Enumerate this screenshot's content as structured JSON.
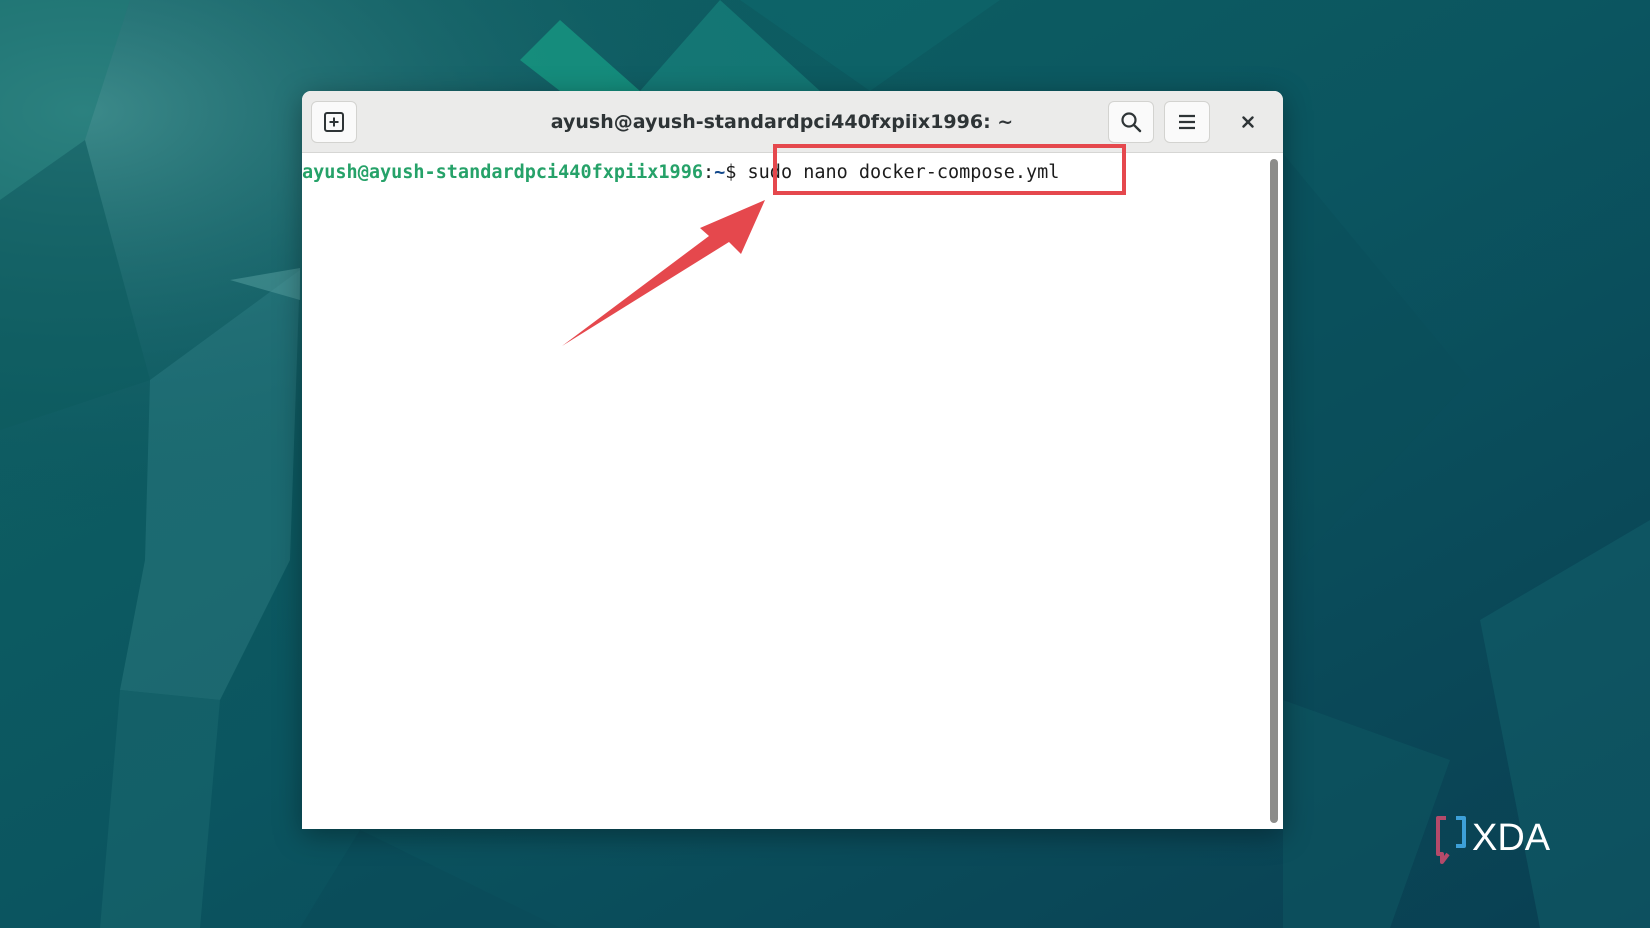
{
  "window": {
    "title": "ayush@ayush-standardpci440fxpiix1996: ~"
  },
  "headerbar": {
    "new_tab_icon": "new-tab-icon",
    "search_icon": "search-icon",
    "menu_icon": "hamburger-menu-icon",
    "close_icon": "close-icon"
  },
  "terminal": {
    "prompt_user_host": "ayush@ayush-standardpci440fxpiix1996",
    "prompt_separator": ":",
    "prompt_path": "~",
    "prompt_symbol": "$ ",
    "command": "sudo nano docker-compose.yml"
  },
  "annotation": {
    "color": "#e5484d"
  },
  "watermark": {
    "brand": "XDA"
  },
  "colors": {
    "desktop_bg": "#0b4f5c",
    "prompt_user": "#26a269",
    "prompt_path": "#12488b"
  }
}
